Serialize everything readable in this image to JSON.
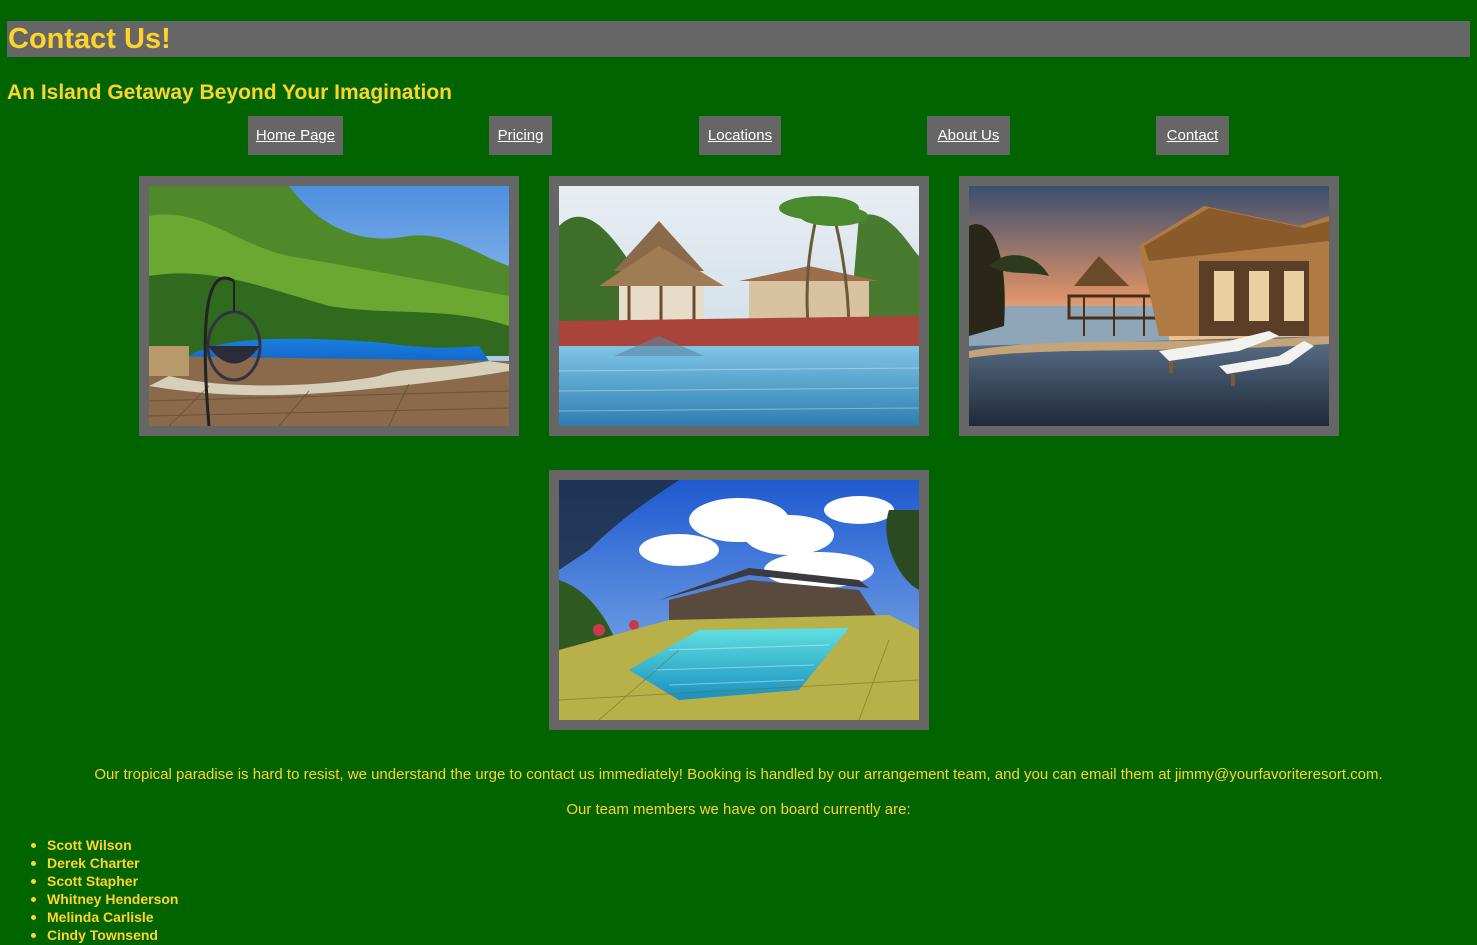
{
  "page": {
    "title": "Contact Us!",
    "subtitle": "An Island Getaway Beyond Your Imagination"
  },
  "nav": {
    "items": [
      {
        "label": "Home Page"
      },
      {
        "label": "Pricing"
      },
      {
        "label": "Locations"
      },
      {
        "label": "About Us"
      },
      {
        "label": "Contact"
      }
    ]
  },
  "gallery": {
    "images": [
      {
        "icon": "resort-pool-hillside-photo"
      },
      {
        "icon": "resort-pool-gazebo-photo"
      },
      {
        "icon": "beach-villa-pool-sunset-photo"
      },
      {
        "icon": "garden-pool-tropical-photo"
      }
    ]
  },
  "content": {
    "intro": "Our tropical paradise is hard to resist, we understand the urge to contact us immediately! Booking is handled by our arrangement team, and you can email them at jimmy@yourfavoriteresort.com.",
    "team_heading": "Our team members we have on board currently are:",
    "team": [
      "Scott Wilson",
      "Derek Charter",
      "Scott Stapher",
      "Whitney Henderson",
      "Melinda Carlisle",
      "Cindy Townsend"
    ]
  },
  "colors": {
    "background": "#006400",
    "accent": "#FFD42A",
    "panel": "#666666",
    "link": "#FFFFFF"
  }
}
